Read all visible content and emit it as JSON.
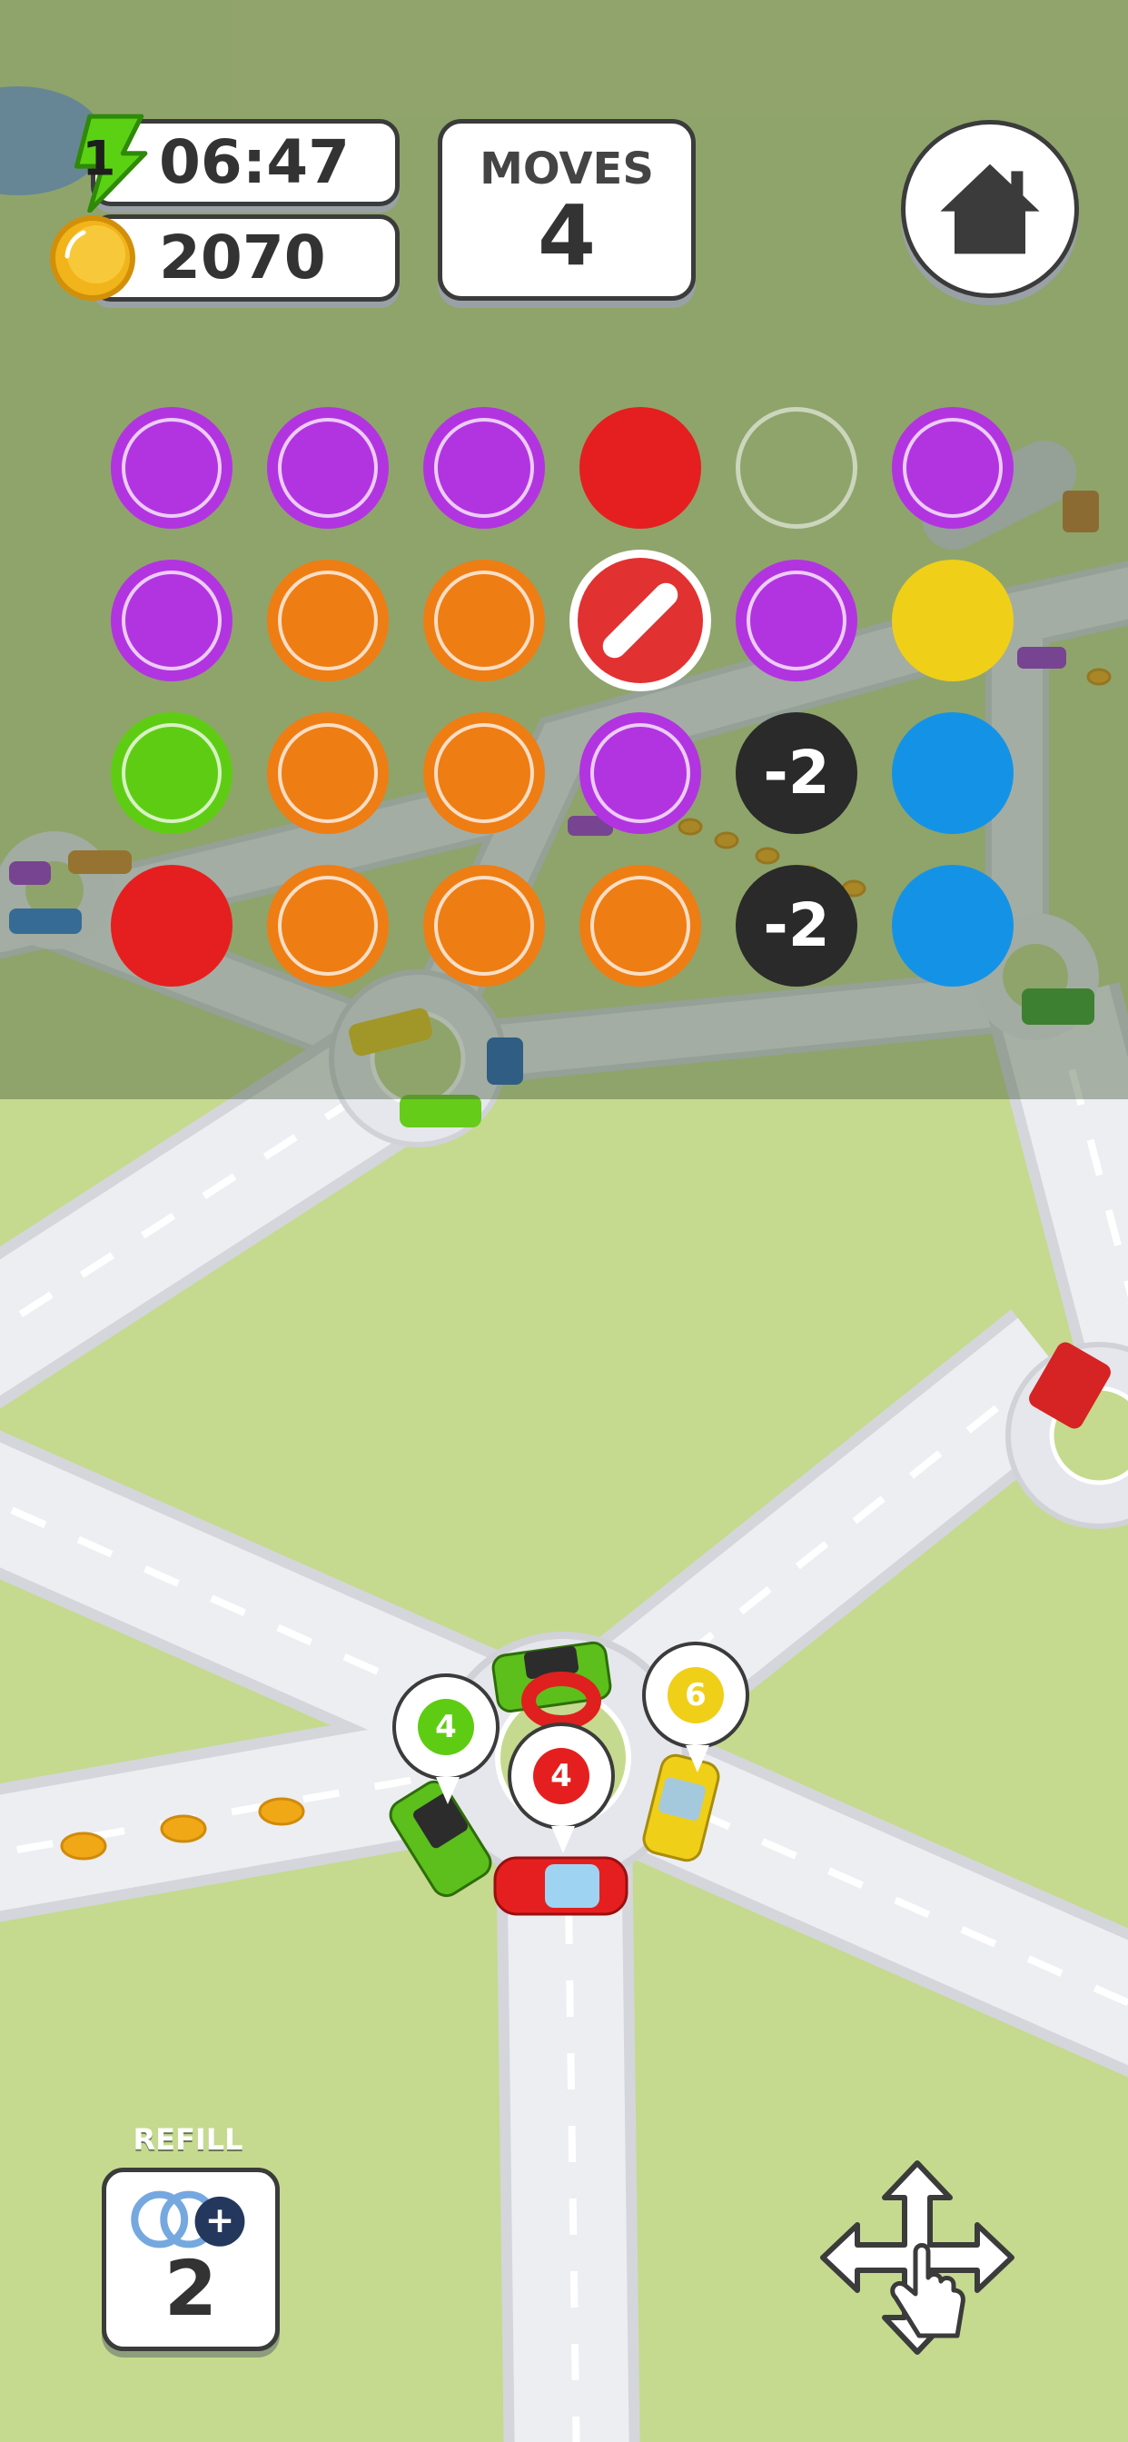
{
  "hud": {
    "level": "1",
    "timer": "06:47",
    "coins": "2070",
    "moves_label": "MOVES",
    "moves_value": "4"
  },
  "colors": {
    "purple": "#b234e0",
    "orange": "#ee7d14",
    "red": "#e51f1f",
    "green": "#5fcc14",
    "yellow": "#f0cf18",
    "blue": "#1493e6",
    "black": "#2a2a2a",
    "grass": "#c5da8e",
    "road": "#e3e4ea"
  },
  "grid": {
    "rows": [
      [
        {
          "type": "color",
          "color": "purple"
        },
        {
          "type": "color",
          "color": "purple"
        },
        {
          "type": "color",
          "color": "purple"
        },
        {
          "type": "color",
          "color": "red"
        },
        {
          "type": "empty"
        },
        {
          "type": "color",
          "color": "purple"
        }
      ],
      [
        {
          "type": "color",
          "color": "purple"
        },
        {
          "type": "color",
          "color": "orange"
        },
        {
          "type": "color",
          "color": "orange"
        },
        {
          "type": "blocked"
        },
        {
          "type": "color",
          "color": "purple"
        },
        {
          "type": "color",
          "color": "yellow"
        }
      ],
      [
        {
          "type": "color",
          "color": "green"
        },
        {
          "type": "color",
          "color": "orange"
        },
        {
          "type": "color",
          "color": "orange"
        },
        {
          "type": "color",
          "color": "purple"
        },
        {
          "type": "bonus",
          "label": "-2"
        },
        {
          "type": "color",
          "color": "blue"
        }
      ],
      [
        {
          "type": "color",
          "color": "red"
        },
        {
          "type": "color",
          "color": "orange"
        },
        {
          "type": "color",
          "color": "orange"
        },
        {
          "type": "color",
          "color": "orange"
        },
        {
          "type": "bonus",
          "label": "-2"
        },
        {
          "type": "color",
          "color": "blue"
        }
      ]
    ]
  },
  "cars": [
    {
      "name": "green-jeep-car",
      "color": "green",
      "capacity": "4"
    },
    {
      "name": "red-sedan-car",
      "color": "red",
      "capacity": "4"
    },
    {
      "name": "yellow-taxi-car",
      "color": "yellow",
      "capacity": "6"
    }
  ],
  "refill": {
    "label": "REFILL",
    "count": "2"
  },
  "icons": {
    "lightning": "lightning-icon",
    "coin": "coin-icon",
    "home": "home-icon",
    "refill": "refill-icon",
    "move": "move-arrows-icon"
  }
}
